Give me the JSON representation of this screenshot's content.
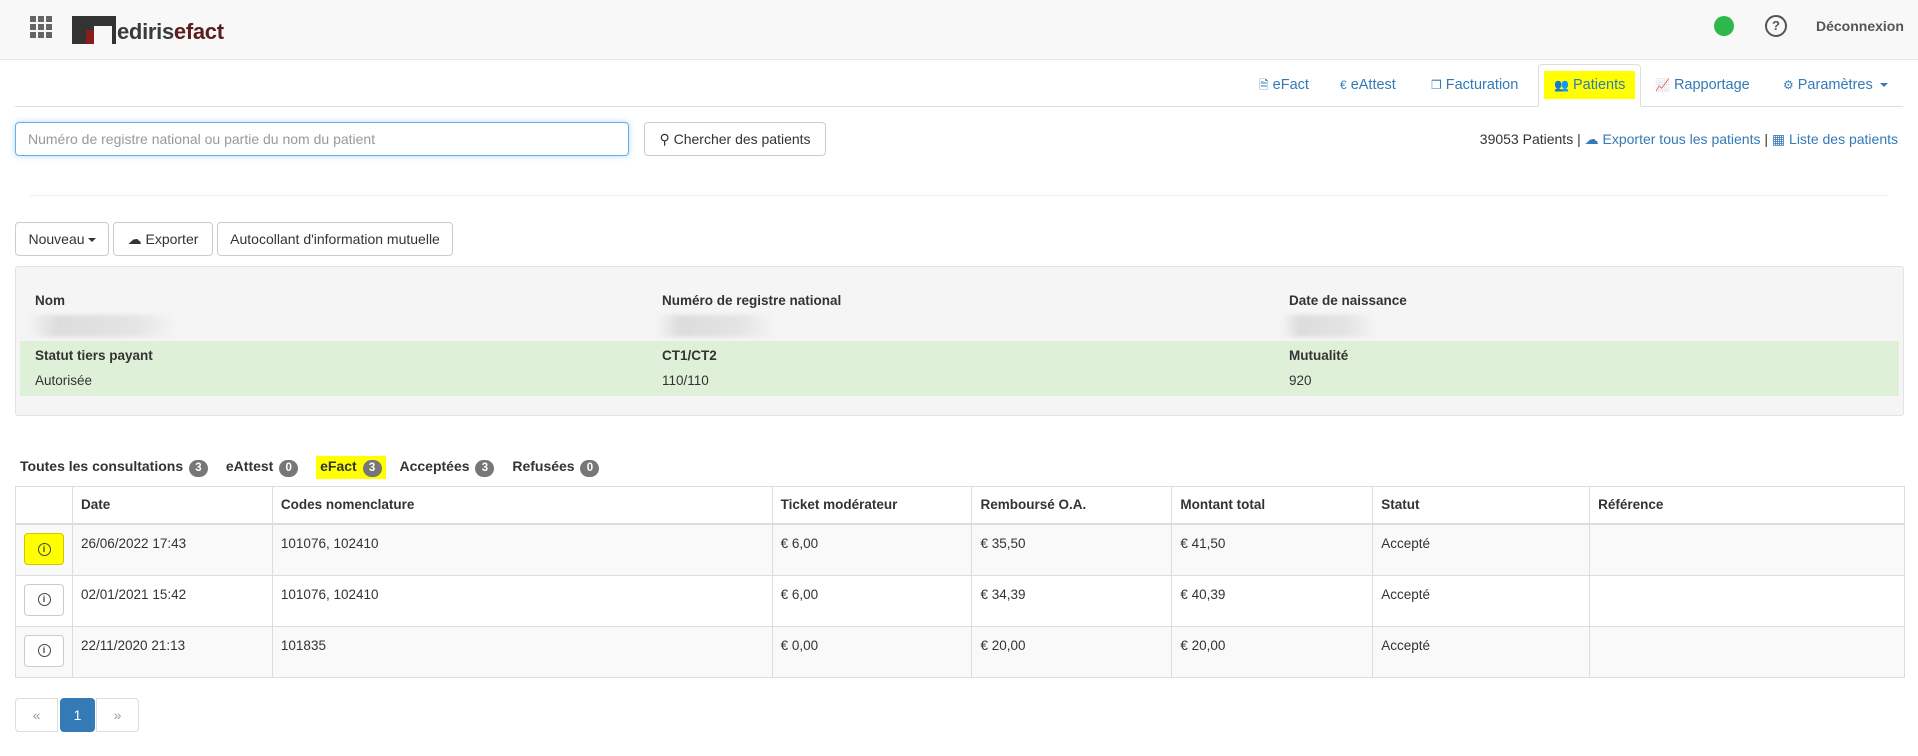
{
  "header": {
    "logo_text_a": "ediris",
    "logo_text_b": "efact",
    "logout": "Déconnexion",
    "help": "?",
    "status_color": "#2db84b"
  },
  "nav": [
    {
      "label": "eFact",
      "icon": "document-icon"
    },
    {
      "label": "eAttest",
      "icon": "euro-icon"
    },
    {
      "label": "Facturation",
      "icon": "copy-icon"
    },
    {
      "label": "Patients",
      "icon": "users-icon"
    },
    {
      "label": "Rapportage",
      "icon": "chart-icon"
    },
    {
      "label": "Paramètres",
      "icon": "gear-icon"
    }
  ],
  "search": {
    "placeholder": "Numéro de registre national ou partie du nom du patient",
    "button": "Chercher des patients"
  },
  "summary": {
    "count": "39053 Patients",
    "sep": "|",
    "export_all": "Exporter tous les patients",
    "list": "Liste des patients"
  },
  "actions": {
    "new": "Nouveau",
    "export": "Exporter",
    "sticker": "Autocollant d'information mutuelle"
  },
  "patient": {
    "name_label": "Nom",
    "nrn_label": "Numéro de registre national",
    "dob_label": "Date de naissance",
    "tp_label": "Statut tiers payant",
    "tp_value": "Autorisée",
    "ct_label": "CT1/CT2",
    "ct_value": "110/110",
    "mut_label": "Mutualité",
    "mut_value": "920"
  },
  "filters": [
    {
      "label": "Toutes les consultations",
      "count": "3"
    },
    {
      "label": "eAttest",
      "count": "0"
    },
    {
      "label": "eFact",
      "count": "3"
    },
    {
      "label": "Acceptées",
      "count": "3"
    },
    {
      "label": "Refusées",
      "count": "0"
    }
  ],
  "table": {
    "headers": [
      "",
      "Date",
      "Codes nomenclature",
      "Ticket modérateur",
      "Remboursé O.A.",
      "Montant total",
      "Statut",
      "Référence"
    ],
    "rows": [
      [
        "26/06/2022 17:43",
        "101076, 102410",
        "€ 6,00",
        "€ 35,50",
        "€ 41,50",
        "Accepté",
        ""
      ],
      [
        "02/01/2021 15:42",
        "101076, 102410",
        "€ 6,00",
        "€ 34,39",
        "€ 40,39",
        "Accepté",
        ""
      ],
      [
        "22/11/2020 21:13",
        "101835",
        "€ 0,00",
        "€ 20,00",
        "€ 20,00",
        "Accepté",
        ""
      ]
    ]
  },
  "pagination": {
    "first": "«",
    "current": "1",
    "last": "»"
  },
  "colors": {
    "highlight": "#ffff00",
    "link": "#337ab7",
    "success_bg": "#dff0d8"
  }
}
